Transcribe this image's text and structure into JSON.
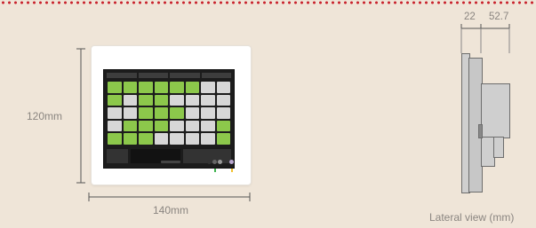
{
  "dimensions": {
    "height_label": "120mm",
    "width_label": "140mm",
    "depth_front_label": "22",
    "depth_back_label": "52.7"
  },
  "lateral_view_caption": "Lateral view (mm)",
  "colors": {
    "background": "#efe5d8",
    "dot_border": "#c9232d",
    "device_body": "#ffffff",
    "screen": "#1c1c1c",
    "tile_on": "#8cc84b",
    "tile_off": "#d7d7d7",
    "line": "#6d6d6d",
    "label_text": "#8a8580"
  },
  "screen_grid": [
    [
      "on",
      "on",
      "on",
      "on",
      "on",
      "on",
      "off",
      "off"
    ],
    [
      "on",
      "off",
      "on",
      "on",
      "off",
      "off",
      "off",
      "off"
    ],
    [
      "off",
      "off",
      "on",
      "on",
      "on",
      "off",
      "off",
      "off"
    ],
    [
      "off",
      "on",
      "on",
      "on",
      "off",
      "off",
      "off",
      "on"
    ],
    [
      "on",
      "on",
      "on",
      "off",
      "off",
      "off",
      "off",
      "on"
    ]
  ],
  "icons": {
    "controller": "touch-panel-controller-icon",
    "status_dots": "status-dots-icon"
  }
}
